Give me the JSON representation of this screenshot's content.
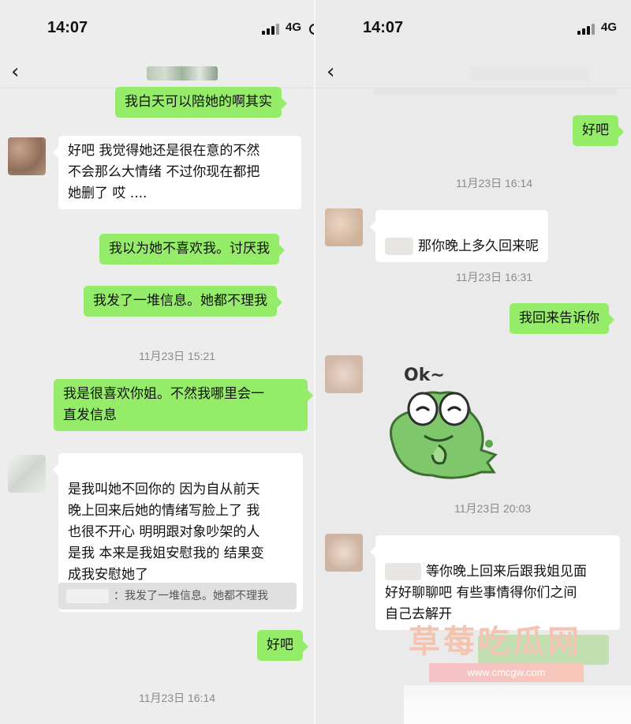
{
  "left": {
    "status": {
      "time": "14:07",
      "network": "4G"
    },
    "nav": {
      "back_icon": "‹"
    },
    "messages": [
      {
        "text": "我白天可以陪她的啊其实"
      },
      {
        "text": "好吧 我觉得她还是很在意的不然\n不会那么大情绪 不过你现在都把\n她删了 哎 ...."
      },
      {
        "text": "我以为她不喜欢我。讨厌我"
      },
      {
        "text": "我发了一堆信息。她都不理我"
      },
      {
        "text": "我是很喜欢你姐。不然我哪里会一\n直发信息"
      },
      {
        "text": "是我叫她不回你的 因为自从前天\n晚上回来后她的情绪写脸上了 我\n也很不开心 明明跟对象吵架的人\n是我 本来是我姐安慰我的 结果变\n成我安慰她了"
      },
      {
        "text": "好吧"
      }
    ],
    "timestamps": [
      "11月23日 15:21",
      "11月23日 16:14"
    ],
    "quote": {
      "text": "：我发了一堆信息。她都不理我"
    }
  },
  "right": {
    "status": {
      "time": "14:07",
      "network": "4G"
    },
    "nav": {
      "back_icon": "‹"
    },
    "messages": [
      {
        "text": "好吧"
      },
      {
        "text": "那你晚上多久回来呢"
      },
      {
        "text": "我回来告诉你"
      },
      {
        "text": "等你晚上回来后跟我姐见面\n好好聊聊吧 有些事情得你们之间\n自己去解开"
      }
    ],
    "timestamps": [
      "11月23日 16:14",
      "11月23日 16:31",
      "11月23日 20:03"
    ],
    "sticker": {
      "text": "Ok~"
    }
  },
  "watermark": {
    "text": "草莓吃瓜网",
    "url": "www.cmcgw.com"
  },
  "colors": {
    "me_bubble": "#95ec69",
    "them_bubble": "#ffffff",
    "background": "#ededed"
  }
}
